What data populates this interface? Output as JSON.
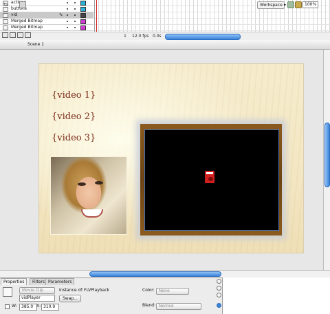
{
  "timeline": {
    "layers": [
      {
        "name": "actions",
        "color": "#2ab3d6",
        "selected": false
      },
      {
        "name": "buttons",
        "color": "#2ab3d6",
        "selected": false
      },
      {
        "name": "vid",
        "color": "#444444",
        "selected": true
      },
      {
        "name": "Merged Bitmap",
        "color": "#d23ad6",
        "selected": false
      },
      {
        "name": "Merged Bitmap",
        "color": "#d23ad6",
        "selected": false
      }
    ],
    "footer": {
      "frame": "1",
      "fps": "12.0 fps",
      "time": "0.0s"
    }
  },
  "editbar": {
    "scene": "Scene 1",
    "workspace": "Workspace ▾",
    "zoom": "100%"
  },
  "stage": {
    "links": [
      "{video 1}",
      "{video 2}",
      "{video 3}"
    ]
  },
  "properties": {
    "tabs": [
      "Properties",
      "Filters",
      "Parameters"
    ],
    "type_select": "Movie Clip",
    "instance_of_label": "Instance of:",
    "instance_of_value": "FLVPlayback",
    "instance_name": "vidPlayer",
    "swap_label": "Swap...",
    "w_label": "W:",
    "w_value": "385.0",
    "x_label": "X:",
    "x_value": "310.9",
    "color_label": "Color:",
    "color_value": "None",
    "blend_label": "Blend:",
    "blend_value": "Normal"
  },
  "colors": {
    "scroll_accent": "#3a83d9",
    "link_text": "#7a2a16",
    "stage_bg": "#f3e6c2"
  }
}
